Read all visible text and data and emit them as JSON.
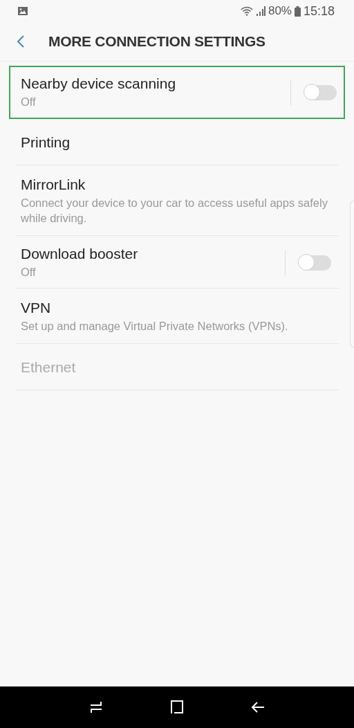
{
  "status_bar": {
    "battery": "80%",
    "time": "15:18"
  },
  "header": {
    "title": "MORE CONNECTION SETTINGS"
  },
  "items": [
    {
      "kind": "switch",
      "title": "Nearby device scanning",
      "summary": "Off",
      "on": false,
      "highlighted": true,
      "disabled": false
    },
    {
      "kind": "plain",
      "title": "Printing",
      "highlighted": false,
      "disabled": false
    },
    {
      "kind": "plain",
      "title": "MirrorLink",
      "summary": "Connect your device to your car to access useful apps safely while driving.",
      "highlighted": false,
      "disabled": false
    },
    {
      "kind": "switch",
      "title": "Download booster",
      "summary": "Off",
      "on": false,
      "highlighted": false,
      "disabled": false
    },
    {
      "kind": "plain",
      "title": "VPN",
      "summary": "Set up and manage Virtual Private Networks (VPNs).",
      "highlighted": false,
      "disabled": false
    },
    {
      "kind": "plain",
      "title": "Ethernet",
      "highlighted": false,
      "disabled": true
    }
  ]
}
